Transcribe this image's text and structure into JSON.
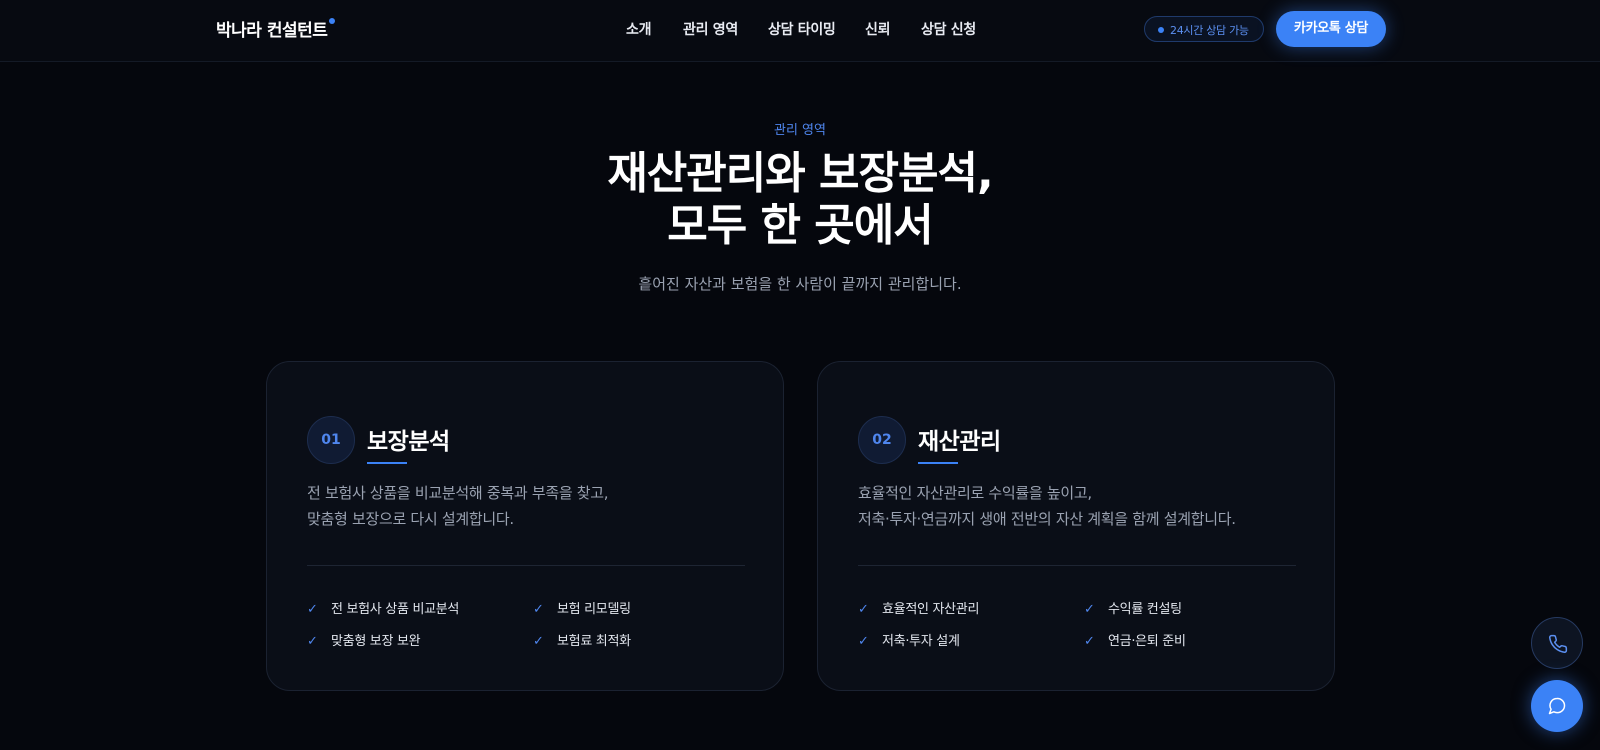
{
  "header": {
    "brand": "박나라 컨설턴트",
    "nav": [
      "소개",
      "관리 영역",
      "상담 타이밍",
      "신뢰",
      "상담 신청"
    ],
    "status": "24시간 상담 가능",
    "cta": "카카오톡 상담"
  },
  "hero": {
    "eyebrow": "관리 영역",
    "title_line1": "재산관리와 보장분석,",
    "title_line2": "모두 한 곳에서",
    "subtitle": "흩어진 자산과 보험을 한 사람이 끝까지 관리합니다."
  },
  "cards": [
    {
      "num": "01",
      "title": "보장분석",
      "desc_line1": "전 보험사 상품을 비교분석해 중복과 부족을 찾고,",
      "desc_line2": "맞춤형 보장으로 다시 설계합니다.",
      "features": [
        "전 보험사 상품 비교분석",
        "보험 리모델링",
        "맞춤형 보장 보완",
        "보험료 최적화"
      ]
    },
    {
      "num": "02",
      "title": "재산관리",
      "desc_line1": "효율적인 자산관리로 수익률을 높이고,",
      "desc_line2": "저축·투자·연금까지 생애 전반의 자산 계획을 함께 설계합니다.",
      "features": [
        "효율적인 자산관리",
        "수익률 컨설팅",
        "저축·투자 설계",
        "연금·은퇴 준비"
      ]
    }
  ],
  "icons": {
    "check": "check-icon",
    "phone": "phone-icon",
    "chat": "chat-icon"
  },
  "colors": {
    "accent": "#3b82f6",
    "background": "#05070d"
  }
}
